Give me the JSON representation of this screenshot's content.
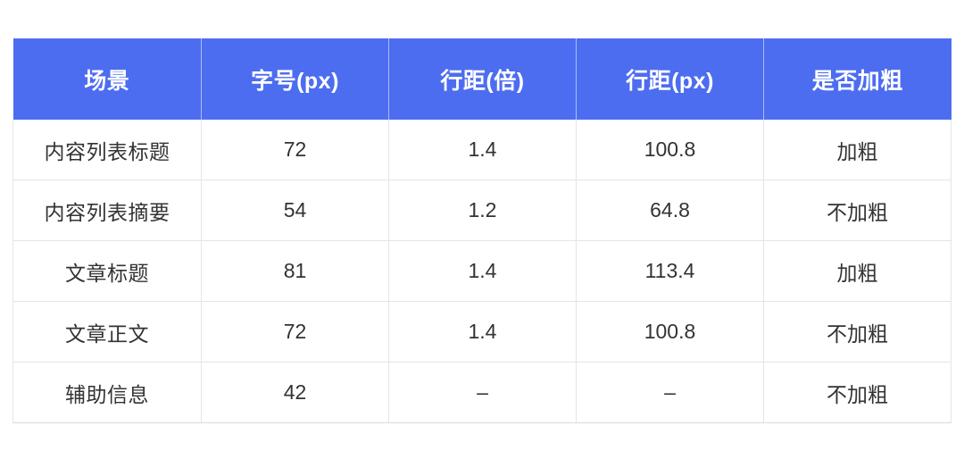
{
  "table": {
    "columns": [
      {
        "key": "scene",
        "label": "场景"
      },
      {
        "key": "font_size",
        "label": "字号(px)"
      },
      {
        "key": "line_height_multiple",
        "label": "行距(倍)"
      },
      {
        "key": "line_height_px",
        "label": "行距(px)"
      },
      {
        "key": "bold",
        "label": "是否加粗"
      }
    ],
    "rows": [
      {
        "scene": "内容列表标题",
        "font_size": "72",
        "line_height_multiple": "1.4",
        "line_height_px": "100.8",
        "bold": "加粗"
      },
      {
        "scene": "内容列表摘要",
        "font_size": "54",
        "line_height_multiple": "1.2",
        "line_height_px": "64.8",
        "bold": "不加粗"
      },
      {
        "scene": "文章标题",
        "font_size": "81",
        "line_height_multiple": "1.4",
        "line_height_px": "113.4",
        "bold": "加粗"
      },
      {
        "scene": "文章正文",
        "font_size": "72",
        "line_height_multiple": "1.4",
        "line_height_px": "100.8",
        "bold": "不加粗"
      },
      {
        "scene": "辅助信息",
        "font_size": "42",
        "line_height_multiple": "–",
        "line_height_px": "–",
        "bold": "不加粗"
      }
    ]
  },
  "colors": {
    "header_background": "#4d6df0",
    "header_text": "#ffffff",
    "header_divider": "#a9bdf7",
    "body_text": "#333333",
    "body_border": "#e3e5e8",
    "page_background": "#ffffff"
  }
}
